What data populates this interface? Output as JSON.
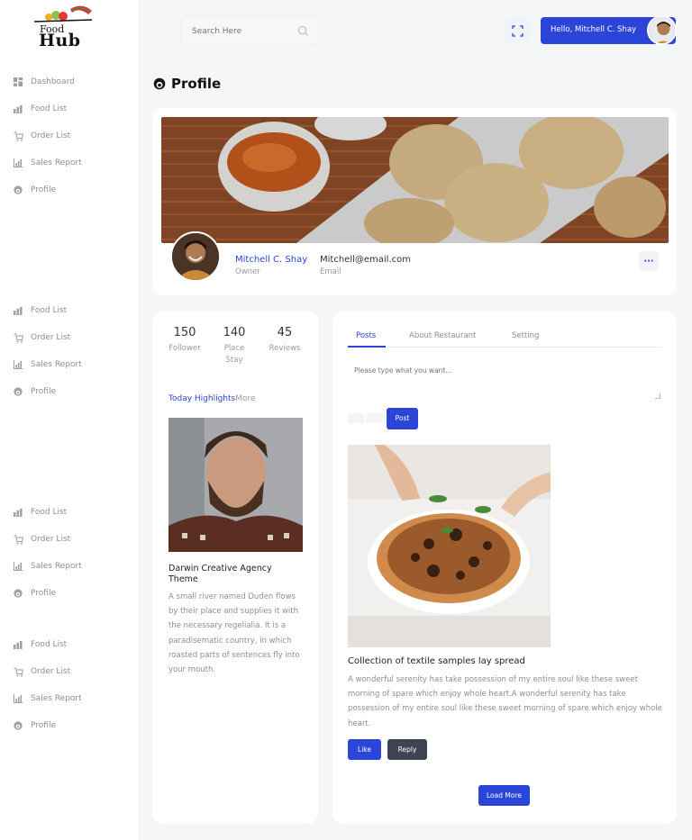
{
  "brand": {
    "line1": "Food",
    "line2": "Hub"
  },
  "sidebar": {
    "groups": [
      {
        "items": [
          {
            "label": "Dashboard",
            "icon": "dashboard-icon"
          },
          {
            "label": "Food List",
            "icon": "bar-chart-icon"
          },
          {
            "label": "Order List",
            "icon": "cart-icon"
          },
          {
            "label": "Sales Report",
            "icon": "chart-icon"
          },
          {
            "label": "Profile",
            "icon": "profile-icon"
          }
        ]
      },
      {
        "items": [
          {
            "label": "Food List",
            "icon": "bar-chart-icon"
          },
          {
            "label": "Order List",
            "icon": "cart-icon"
          },
          {
            "label": "Sales Report",
            "icon": "chart-icon"
          },
          {
            "label": "Profile",
            "icon": "profile-icon"
          }
        ]
      },
      {
        "items": [
          {
            "label": "Food List",
            "icon": "bar-chart-icon"
          },
          {
            "label": "Order List",
            "icon": "cart-icon"
          },
          {
            "label": "Sales Report",
            "icon": "chart-icon"
          },
          {
            "label": "Profile",
            "icon": "profile-icon"
          }
        ]
      },
      {
        "items": [
          {
            "label": "Food List",
            "icon": "bar-chart-icon"
          },
          {
            "label": "Order List",
            "icon": "cart-icon"
          },
          {
            "label": "Sales Report",
            "icon": "chart-icon"
          },
          {
            "label": "Profile",
            "icon": "profile-icon"
          }
        ]
      }
    ]
  },
  "header": {
    "search_placeholder": "Search Here",
    "greeting": "Hello, Mitchell C. Shay"
  },
  "page": {
    "title": "Profile"
  },
  "profile": {
    "name": "Mitchell C. Shay",
    "role": "Owner",
    "email": "Mitchell@email.com",
    "email_label": "Email",
    "more_label": "···"
  },
  "stats": [
    {
      "value": "150",
      "label": "Follower"
    },
    {
      "value": "140",
      "label": "Place Stay"
    },
    {
      "value": "45",
      "label": "Reviews"
    }
  ],
  "highlights": {
    "title": "Today Highlights",
    "more": "More",
    "heading": "Darwin Creative Agency Theme",
    "text": "A small river named Duden flows by their place and supplies it with the necessary regelialia. It is a paradisematic country, in which roasted parts of sentences fly into your mouth."
  },
  "tabs": [
    {
      "label": "Posts",
      "active": true
    },
    {
      "label": "About Restaurant",
      "active": false
    },
    {
      "label": "Setting",
      "active": false
    }
  ],
  "composer": {
    "placeholder": "Please type what you want...",
    "post_label": "Post"
  },
  "post": {
    "title": "Collection of textile samples lay spread",
    "body": "A wonderful serenity has take possession of my entire soul like these sweet morning of spare which enjoy whole heart.A wonderful serenity has take possession of my entire soul like these sweet morning of spare which enjoy whole heart.",
    "like_label": "Like",
    "reply_label": "Reply"
  },
  "load_more_label": "Load More",
  "colors": {
    "accent": "#2a45d8",
    "dark_button": "#3e4450",
    "muted_text": "#8a8f99",
    "background": "#f5f6f8"
  }
}
